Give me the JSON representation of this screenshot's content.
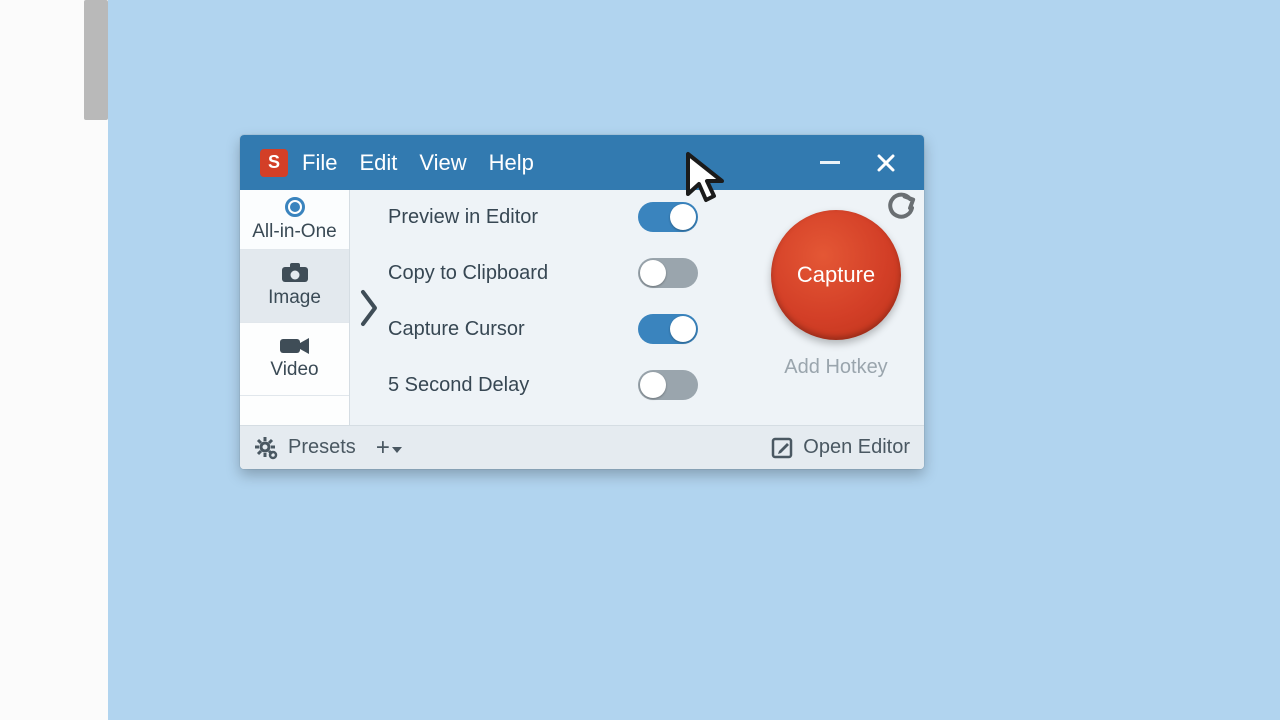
{
  "app": {
    "logo_letter": "S"
  },
  "menu": {
    "file": "File",
    "edit": "Edit",
    "view": "View",
    "help": "Help"
  },
  "sidebar": {
    "all_in_one": "All-in-One",
    "image": "Image",
    "video": "Video",
    "selected": "image"
  },
  "options": {
    "preview_in_editor": {
      "label": "Preview in Editor",
      "on": true
    },
    "copy_to_clipboard": {
      "label": "Copy to Clipboard",
      "on": false
    },
    "capture_cursor": {
      "label": "Capture Cursor",
      "on": true
    },
    "five_second_delay": {
      "label": "5 Second Delay",
      "on": false
    }
  },
  "capture": {
    "button_label": "Capture",
    "add_hotkey": "Add Hotkey"
  },
  "footer": {
    "presets": "Presets",
    "open_editor": "Open Editor"
  }
}
